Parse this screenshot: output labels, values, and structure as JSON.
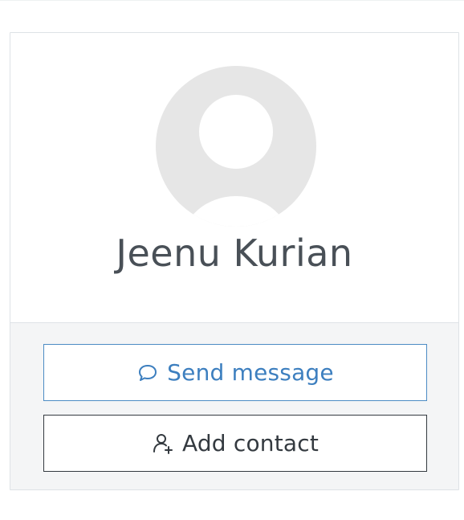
{
  "profile": {
    "name": "Jeenu Kurian",
    "avatar_icon": "user-avatar-icon"
  },
  "actions": {
    "send_message_label": "Send message",
    "send_message_icon": "speech-bubble-icon",
    "add_contact_label": "Add contact",
    "add_contact_icon": "user-plus-icon"
  },
  "colors": {
    "message_button": "#3d7fbf",
    "contact_button": "#343a40",
    "name_text": "#495057",
    "avatar_placeholder": "#e6e6e6",
    "footer_background": "#f4f5f6"
  }
}
